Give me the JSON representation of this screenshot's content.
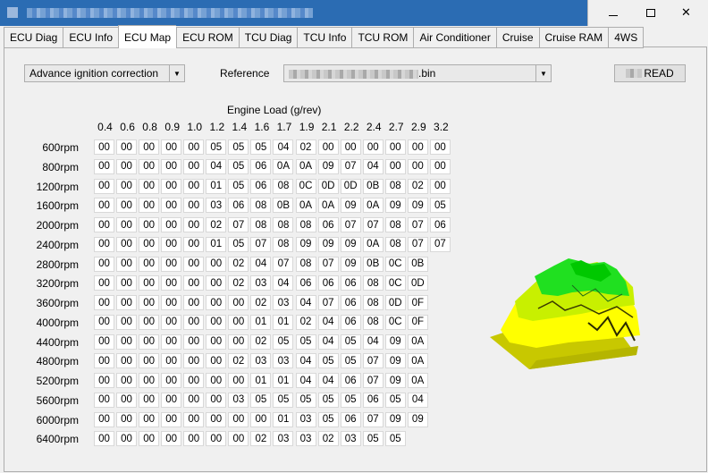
{
  "window": {
    "title": "",
    "buttons": {
      "minimize": "–",
      "maximize": "□",
      "close": "✕"
    }
  },
  "tabs": [
    {
      "label": "ECU Diag"
    },
    {
      "label": "ECU Info"
    },
    {
      "label": "ECU Map",
      "active": true
    },
    {
      "label": "ECU ROM"
    },
    {
      "label": "TCU Diag"
    },
    {
      "label": "TCU Info"
    },
    {
      "label": "TCU ROM"
    },
    {
      "label": "Air Conditioner"
    },
    {
      "label": "Cruise"
    },
    {
      "label": "Cruise RAM"
    },
    {
      "label": "4WS"
    }
  ],
  "toolbar": {
    "map_select": "Advance ignition correction",
    "reference_label": "Reference",
    "reference_value_suffix": ".bin",
    "read_label": "READ"
  },
  "map": {
    "axis_title": "Engine Load (g/rev)",
    "columns": [
      "0.4",
      "0.6",
      "0.8",
      "0.9",
      "1.0",
      "1.2",
      "1.4",
      "1.6",
      "1.7",
      "1.9",
      "2.1",
      "2.2",
      "2.4",
      "2.7",
      "2.9",
      "3.2"
    ],
    "rows": [
      "600rpm",
      "800rpm",
      "1200rpm",
      "1600rpm",
      "2000rpm",
      "2400rpm",
      "2800rpm",
      "3200rpm",
      "3600rpm",
      "4000rpm",
      "4400rpm",
      "4800rpm",
      "5200rpm",
      "5600rpm",
      "6000rpm",
      "6400rpm"
    ],
    "values": [
      [
        "00",
        "00",
        "00",
        "00",
        "00",
        "05",
        "05",
        "05",
        "04",
        "02",
        "00",
        "00",
        "00",
        "00",
        "00",
        "00"
      ],
      [
        "00",
        "00",
        "00",
        "00",
        "00",
        "04",
        "05",
        "06",
        "0A",
        "0A",
        "09",
        "07",
        "04",
        "00",
        "00",
        "00"
      ],
      [
        "00",
        "00",
        "00",
        "00",
        "00",
        "01",
        "05",
        "06",
        "08",
        "0C",
        "0D",
        "0D",
        "0B",
        "08",
        "02",
        "00"
      ],
      [
        "00",
        "00",
        "00",
        "00",
        "00",
        "03",
        "06",
        "08",
        "0B",
        "0A",
        "0A",
        "09",
        "0A",
        "09",
        "09",
        "05"
      ],
      [
        "00",
        "00",
        "00",
        "00",
        "00",
        "02",
        "07",
        "08",
        "08",
        "08",
        "06",
        "07",
        "07",
        "08",
        "07",
        "06"
      ],
      [
        "00",
        "00",
        "00",
        "00",
        "00",
        "01",
        "05",
        "07",
        "08",
        "09",
        "09",
        "09",
        "0A",
        "08",
        "07",
        "07"
      ],
      [
        "00",
        "00",
        "00",
        "00",
        "00",
        "00",
        "02",
        "04",
        "07",
        "08",
        "07",
        "09",
        "0B",
        "0C",
        "0B"
      ],
      [
        "00",
        "00",
        "00",
        "00",
        "00",
        "00",
        "02",
        "03",
        "04",
        "06",
        "06",
        "06",
        "08",
        "0C",
        "0D"
      ],
      [
        "00",
        "00",
        "00",
        "00",
        "00",
        "00",
        "00",
        "02",
        "03",
        "04",
        "07",
        "06",
        "08",
        "0D",
        "0F"
      ],
      [
        "00",
        "00",
        "00",
        "00",
        "00",
        "00",
        "00",
        "01",
        "01",
        "02",
        "04",
        "06",
        "08",
        "0C",
        "0F"
      ],
      [
        "00",
        "00",
        "00",
        "00",
        "00",
        "00",
        "00",
        "02",
        "05",
        "05",
        "04",
        "05",
        "04",
        "09",
        "0A"
      ],
      [
        "00",
        "00",
        "00",
        "00",
        "00",
        "00",
        "02",
        "03",
        "03",
        "04",
        "05",
        "05",
        "07",
        "09",
        "0A"
      ],
      [
        "00",
        "00",
        "00",
        "00",
        "00",
        "00",
        "00",
        "01",
        "01",
        "04",
        "04",
        "06",
        "07",
        "09",
        "0A"
      ],
      [
        "00",
        "00",
        "00",
        "00",
        "00",
        "00",
        "03",
        "05",
        "05",
        "05",
        "05",
        "05",
        "06",
        "05",
        "04"
      ],
      [
        "00",
        "00",
        "00",
        "00",
        "00",
        "00",
        "00",
        "00",
        "01",
        "03",
        "05",
        "06",
        "07",
        "09",
        "09"
      ],
      [
        "00",
        "00",
        "00",
        "00",
        "00",
        "00",
        "00",
        "02",
        "03",
        "03",
        "02",
        "03",
        "05",
        "05"
      ]
    ]
  },
  "colors": {
    "surface_low": "#c8c800",
    "surface_mid": "#ffff00",
    "surface_high": "#00e000"
  }
}
